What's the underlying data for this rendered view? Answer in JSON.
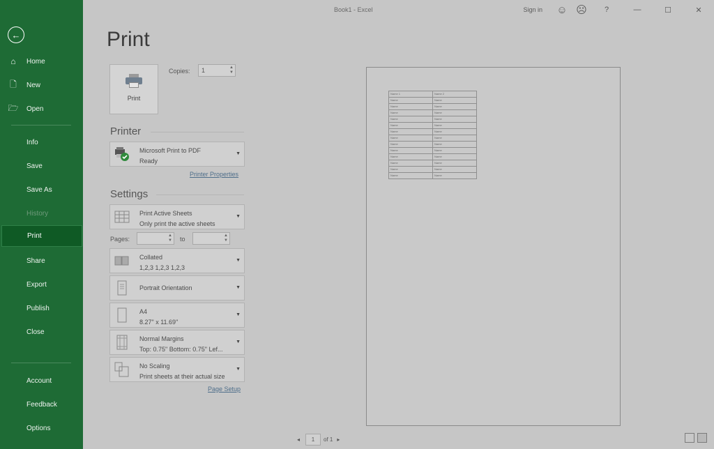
{
  "window": {
    "title": "Book1 - Excel",
    "sign_in": "Sign in",
    "help": "?",
    "minimize": "—",
    "maximize": "☐",
    "close": "✕"
  },
  "sidebar": {
    "back_icon": "←",
    "top_items": [
      {
        "label": "Home",
        "icon": "⌂"
      },
      {
        "label": "New",
        "icon": "🗋"
      },
      {
        "label": "Open",
        "icon": "🗁"
      }
    ],
    "mid_items": [
      "Info",
      "Save",
      "Save As",
      "History",
      "Print",
      "Share",
      "Export",
      "Publish",
      "Close"
    ],
    "bottom_items": [
      "Account",
      "Feedback",
      "Options"
    ],
    "selected": "Print",
    "disabled": "History"
  },
  "print": {
    "heading": "Print",
    "button_label": "Print",
    "copies_label": "Copies:",
    "copies_value": "1"
  },
  "printer": {
    "heading": "Printer",
    "name": "Microsoft Print to PDF",
    "status": "Ready",
    "properties_link": "Printer Properties"
  },
  "settings": {
    "heading": "Settings",
    "what": {
      "title": "Print Active Sheets",
      "subtitle": "Only print the active sheets"
    },
    "pages_label": "Pages:",
    "to_label": "to",
    "collation": {
      "title": "Collated",
      "subtitle": "1,2,3    1,2,3    1,2,3"
    },
    "orientation": {
      "title": "Portrait Orientation"
    },
    "paper": {
      "title": "A4",
      "subtitle": "8.27\" x 11.69\""
    },
    "margins": {
      "title": "Normal Margins",
      "subtitle": "Top: 0.75\" Bottom: 0.75\" Lef..."
    },
    "scaling": {
      "title": "No Scaling",
      "subtitle": "Print sheets at their actual size"
    },
    "page_setup_link": "Page Setup"
  },
  "preview": {
    "table": [
      [
        "Name 1",
        "Name 2"
      ],
      [
        "Name",
        "Name"
      ],
      [
        "Name",
        "Name"
      ],
      [
        "Name",
        "Name"
      ],
      [
        "Name",
        "Name"
      ],
      [
        "Name",
        "Name"
      ],
      [
        "Name",
        "Name"
      ],
      [
        "Name",
        "Name"
      ],
      [
        "Name",
        "Name"
      ],
      [
        "Name",
        "Name"
      ],
      [
        "Name",
        "Name"
      ],
      [
        "Name",
        "Name"
      ],
      [
        "Name",
        "Name"
      ],
      [
        "Name",
        "Name"
      ]
    ],
    "current_page": "1",
    "of_pages": "of 1"
  }
}
